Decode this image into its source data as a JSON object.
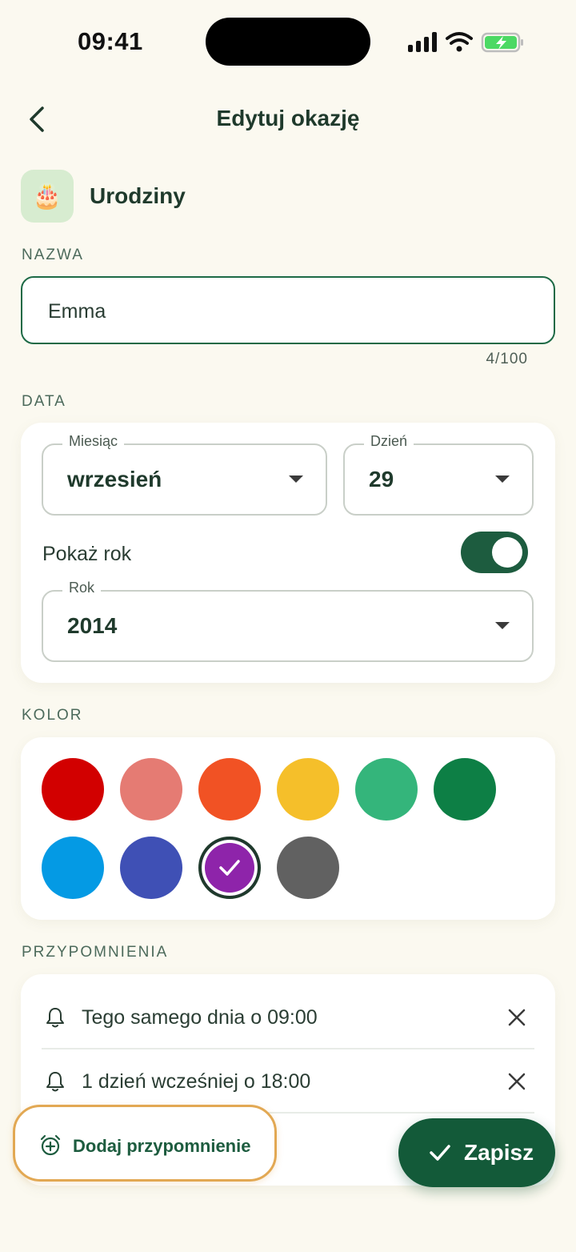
{
  "status_bar": {
    "time": "09:41"
  },
  "header": {
    "title": "Edytuj okazję"
  },
  "occasion_type": {
    "emoji": "🎂",
    "label": "Urodziny"
  },
  "name_section": {
    "label": "NAZWA",
    "value": "Emma",
    "char_count": "4/100"
  },
  "date_section": {
    "label": "DATA",
    "month": {
      "label": "Miesiąc",
      "value": "wrzesień"
    },
    "day": {
      "label": "Dzień",
      "value": "29"
    },
    "show_year": {
      "label": "Pokaż rok",
      "enabled": true
    },
    "year": {
      "label": "Rok",
      "value": "2014"
    }
  },
  "color_section": {
    "label": "KOLOR",
    "colors": [
      "#d20000",
      "#e57b73",
      "#f15224",
      "#f5bf2a",
      "#34b57b",
      "#0d7f45",
      "#049ae4",
      "#3f50b5",
      "#8e24aa",
      "#616161"
    ],
    "selected_index": 8
  },
  "reminders_section": {
    "label": "PRZYPOMNIENIA",
    "items": [
      {
        "text": "Tego samego dnia o 09:00"
      },
      {
        "text": "1 dzień wcześniej o 18:00"
      }
    ],
    "add_label": "Dodaj przypomnienie"
  },
  "save_button": {
    "label": "Zapisz"
  },
  "accent_colors": {
    "primary": "#135a39",
    "highlight": "#e2a853"
  }
}
